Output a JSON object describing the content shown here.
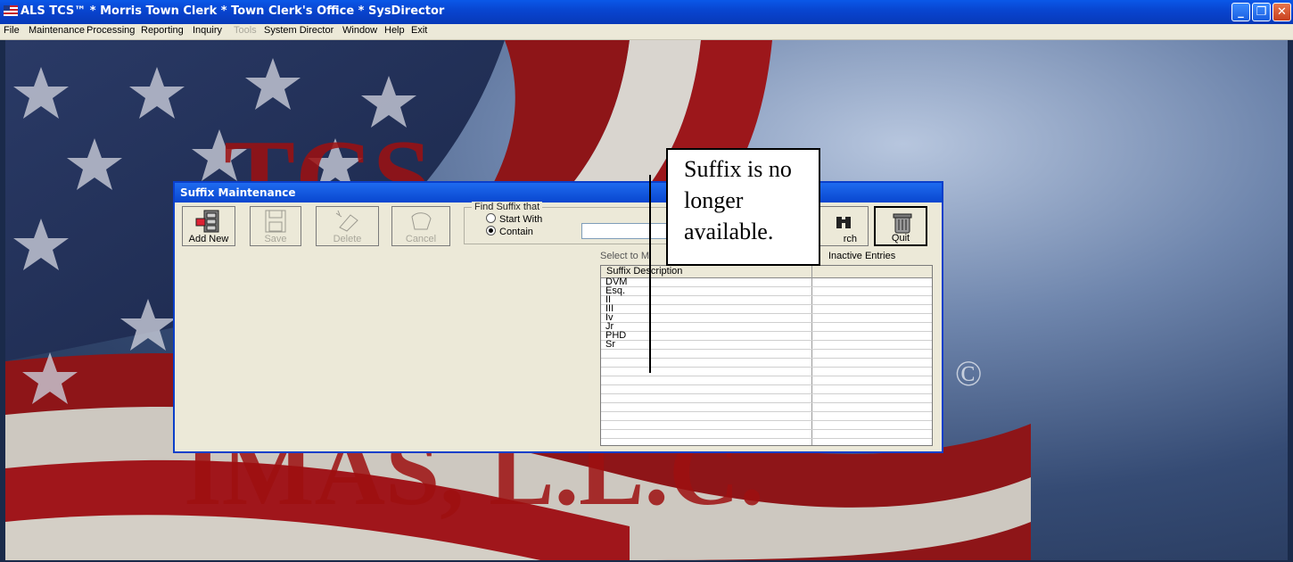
{
  "window": {
    "title": "ALS TCS™ * Morris Town Clerk * Town Clerk's Office * SysDirector",
    "controls": [
      "minimize",
      "restore",
      "close"
    ]
  },
  "menu": [
    {
      "label": "File",
      "disabled": false
    },
    {
      "label": "Maintenance",
      "disabled": false
    },
    {
      "label": "Processing",
      "disabled": false
    },
    {
      "label": "Reporting",
      "disabled": false
    },
    {
      "label": "Inquiry",
      "disabled": false
    },
    {
      "label": "Tools",
      "disabled": true
    },
    {
      "label": "System Director",
      "disabled": false
    },
    {
      "label": "Window",
      "disabled": false
    },
    {
      "label": "Help",
      "disabled": false
    },
    {
      "label": "Exit",
      "disabled": false
    }
  ],
  "background": {
    "text_top": "TCS",
    "text_bottom": "IMAS, L.L.C.",
    "copyright": "©"
  },
  "dialog": {
    "title": "Suffix Maintenance",
    "toolbar": {
      "add_new": "Add New",
      "save": "Save",
      "delete": "Delete",
      "cancel": "Cancel",
      "search": "rch",
      "quit": "Quit"
    },
    "find": {
      "legend": "Find Suffix that",
      "start_with": "Start With",
      "contain": "Contain",
      "selected": "Contain",
      "value": ""
    },
    "select_label": "Select to M",
    "inactive_label": "Inactive Entries",
    "grid": {
      "column": "Suffix Description",
      "rows": [
        "DVM",
        "Esq.",
        "II",
        "III",
        "Iv",
        "Jr",
        "PHD",
        "Sr"
      ]
    }
  },
  "annotation": {
    "line1": "Suffix is no",
    "line2": "longer",
    "line3": "available."
  },
  "colors": {
    "titlebar": "#0a58e8",
    "dialog_title": "#1f6bef",
    "menubar": "#ece9d8",
    "flag_red": "#b3121a"
  }
}
